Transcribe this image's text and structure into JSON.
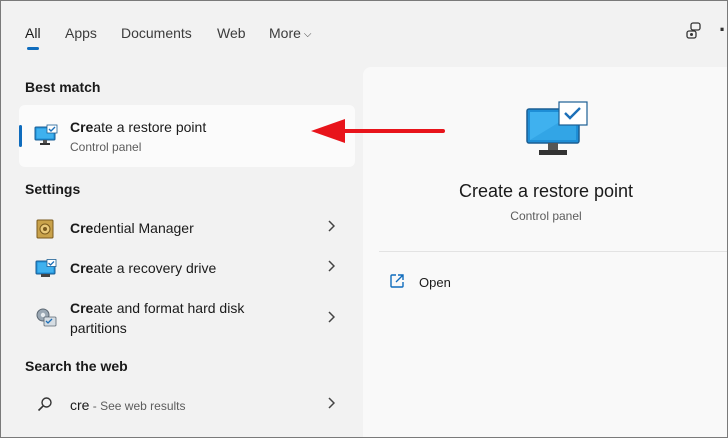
{
  "tabs": {
    "all": "All",
    "apps": "Apps",
    "documents": "Documents",
    "web": "Web",
    "more": "More",
    "more_chevron": "⌵",
    "options": "·"
  },
  "best_match": {
    "header": "Best match",
    "title_bold": "Cre",
    "title_rest": "ate a restore point",
    "subtitle": "Control panel"
  },
  "settings": {
    "header": "Settings",
    "items": [
      {
        "bold": "Cre",
        "rest": "dential Manager"
      },
      {
        "bold": "Cre",
        "rest": "ate a recovery drive"
      },
      {
        "bold": "Cre",
        "rest_line1": "ate and format hard disk",
        "line2": "partitions"
      }
    ]
  },
  "web": {
    "header": "Search the web",
    "query": "cre",
    "suffix": " - See web results"
  },
  "detail": {
    "title": "Create a restore point",
    "subtitle": "Control panel",
    "open_label": "Open"
  },
  "colors": {
    "accent": "#0f6cbd",
    "annotation_arrow": "#e8141b"
  }
}
